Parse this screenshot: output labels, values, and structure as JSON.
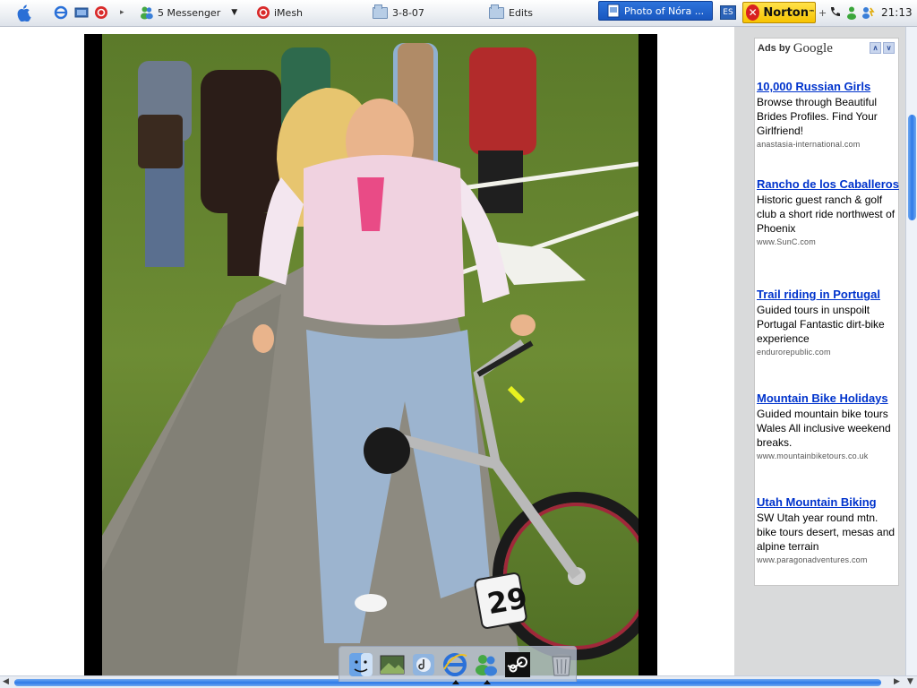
{
  "taskbar": {
    "apps": [
      {
        "label": "5 Messenger",
        "icon": "messenger-icon"
      },
      {
        "label": "iMesh",
        "icon": "imesh-icon"
      },
      {
        "label": "3-8-07",
        "icon": "folder-icon"
      },
      {
        "label": "Edits",
        "icon": "folder-icon"
      },
      {
        "label": "Photo of Nóra ...",
        "icon": "folder-icon",
        "active": true
      }
    ],
    "language": "ES",
    "norton_label": "Norton",
    "norton_tm": "™",
    "clock": "21:13"
  },
  "ads": {
    "header_prefix": "Ads by",
    "header_brand": "Google",
    "items": [
      {
        "title": "10,000 Russian Girls",
        "desc": "Browse through Beautiful Brides Profiles. Find Your Girlfriend!",
        "url": "anastasia-international.com"
      },
      {
        "title": "Rancho de los Caballeros",
        "desc": "Historic guest ranch & golf club a short ride northwest of Phoenix",
        "url": "www.SunC.com"
      },
      {
        "title": "Trail riding in Portugal",
        "desc": "Guided tours in unspoilt Portugal Fantastic dirt-bike experience",
        "url": "endurorepublic.com"
      },
      {
        "title": "Mountain Bike Holidays",
        "desc": "Guided mountain bike tours Wales All inclusive weekend breaks.",
        "url": "www.mountainbiketours.co.uk"
      },
      {
        "title": "Utah Mountain Biking",
        "desc": "SW Utah year round mtn. bike tours desert, mesas and alpine terrain",
        "url": "www.paragonadventures.com"
      }
    ]
  },
  "photo": {
    "bike_number": "29"
  },
  "colors": {
    "ad_link": "#0033cc",
    "taskbar_active": "#1f63d0",
    "norton_yellow": "#f7c300",
    "scroll_blue": "#2e7ae8"
  }
}
